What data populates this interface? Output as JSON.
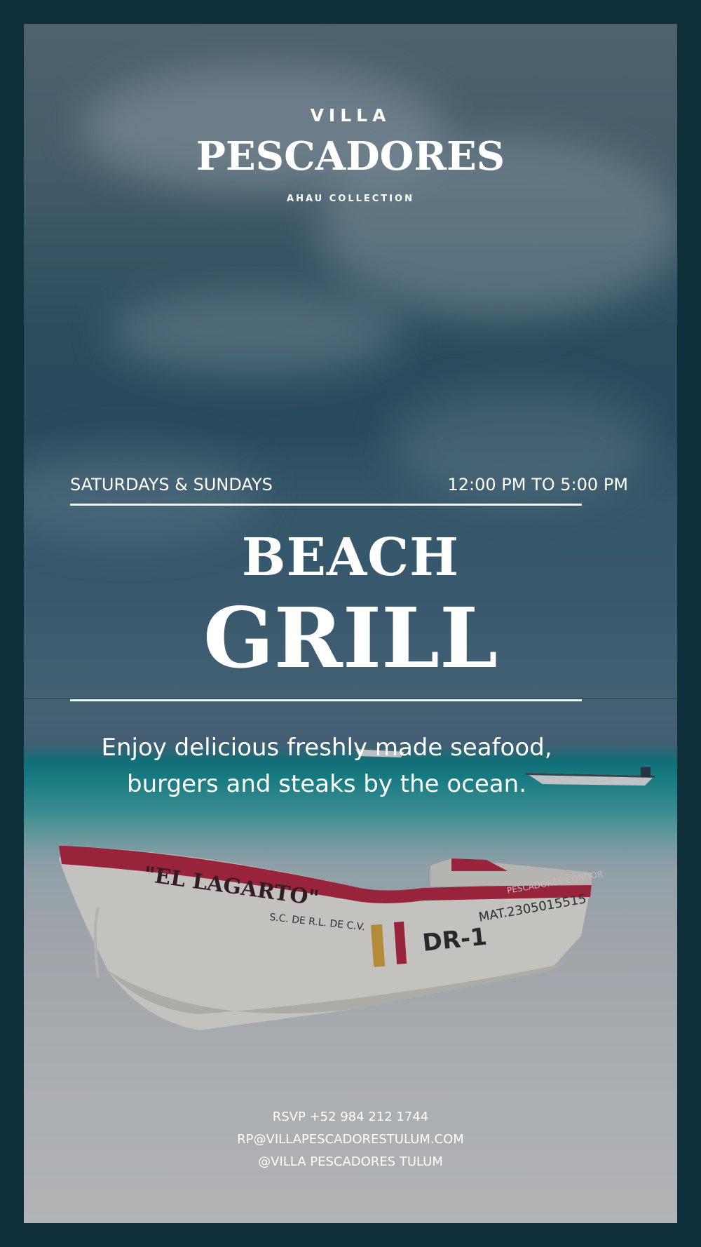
{
  "brand": {
    "line1": "VILLA",
    "line2": "PESCADORES",
    "line3": "AHAU COLLECTION"
  },
  "schedule": {
    "days": "SATURDAYS & SUNDAYS",
    "hours": "12:00 PM TO 5:00 PM"
  },
  "title": {
    "line1": "BEACH",
    "line2": "GRILL"
  },
  "description": {
    "line1": "Enjoy delicious freshly made seafood,",
    "line2": "burgers and steaks by the ocean."
  },
  "contact": {
    "rsvp": "RSVP +52 984 212 1744",
    "email": "RP@VILLAPESCADORESTULUM.COM",
    "social": "@VILLA PESCADORES TULUM"
  },
  "boat_markings": {
    "name": "\"EL LAGARTO\"",
    "company": "S.C. DE R.L. DE C.V.",
    "registration": "MAT.2305015515",
    "code": "DR-1",
    "side_text": "PESCADORES CONDOR"
  },
  "colors": {
    "frame": "#0f2f3a",
    "text": "#ffffff",
    "boat_red": "#b5243c"
  }
}
